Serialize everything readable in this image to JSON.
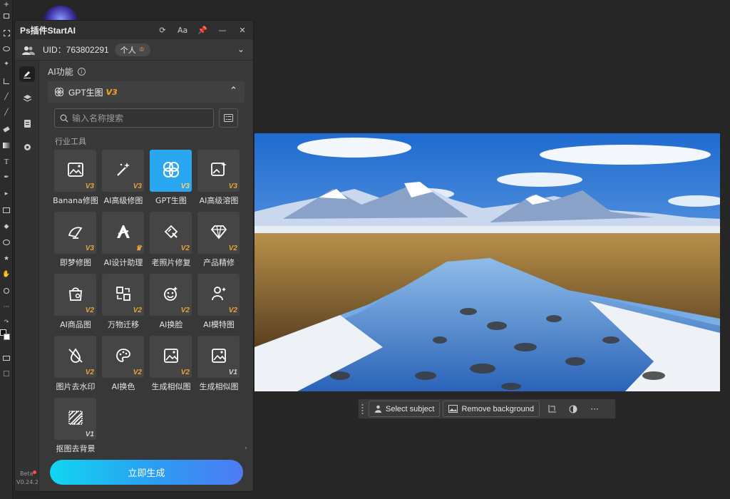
{
  "panel": {
    "title": "Ps插件StartAI",
    "title_icons": [
      "refresh-icon",
      "font-size-icon",
      "pin-icon",
      "minimize-icon",
      "close-icon"
    ],
    "font_size_label": "Aa",
    "uid_text": "UID：763802291",
    "plan_label": "个人",
    "section_title": "AI功能",
    "info_glyph": "i",
    "category": {
      "label": "GPT生图",
      "version": "V3"
    },
    "search": {
      "placeholder": "输入名称搜索"
    },
    "group_label": "行业工具",
    "tools": [
      {
        "label": "Banana修图",
        "version": "V3",
        "icon": "image-edit-icon"
      },
      {
        "label": "AI高级修图",
        "version": "V3",
        "icon": "magic-wand-icon"
      },
      {
        "label": "GPT生图",
        "version": "V3",
        "icon": "gpt-icon",
        "selected": true
      },
      {
        "label": "AI高级溶图",
        "version": "V3",
        "icon": "image-sparkle-icon"
      },
      {
        "label": "即梦修图",
        "version": "V3",
        "icon": "jimeng-icon"
      },
      {
        "label": "AI设计助理",
        "version": "",
        "icon": "design-assistant-icon"
      },
      {
        "label": "老照片修复",
        "version": "V2",
        "icon": "photo-repair-icon"
      },
      {
        "label": "产品精修",
        "version": "V2",
        "icon": "diamond-icon"
      },
      {
        "label": "AI商品图",
        "version": "V2",
        "icon": "shopping-bag-icon"
      },
      {
        "label": "万物迁移",
        "version": "V2",
        "icon": "transfer-icon"
      },
      {
        "label": "AI换脸",
        "version": "V2",
        "icon": "face-swap-icon"
      },
      {
        "label": "AI模特图",
        "version": "V2",
        "icon": "model-icon"
      },
      {
        "label": "图片去水印",
        "version": "V2",
        "icon": "remove-watermark-icon"
      },
      {
        "label": "AI换色",
        "version": "V2",
        "icon": "palette-icon"
      },
      {
        "label": "生成相似图",
        "version": "V2",
        "icon": "similar-image-icon"
      },
      {
        "label": "生成相似图",
        "version": "V1",
        "icon": "similar-image-icon"
      },
      {
        "label": "抠图去背景",
        "version": "V1",
        "icon": "cutout-icon"
      }
    ],
    "generate_label": "立即生成",
    "beta_label": "Beta",
    "version_label": "V0.24.2"
  },
  "taskbar": {
    "select_subject": "Select subject",
    "remove_background": "Remove background"
  },
  "colors": {
    "accent": "#2aa7f0",
    "version_gold": "#e8a33a",
    "panel_bg": "#383838",
    "app_bg": "#262626"
  }
}
